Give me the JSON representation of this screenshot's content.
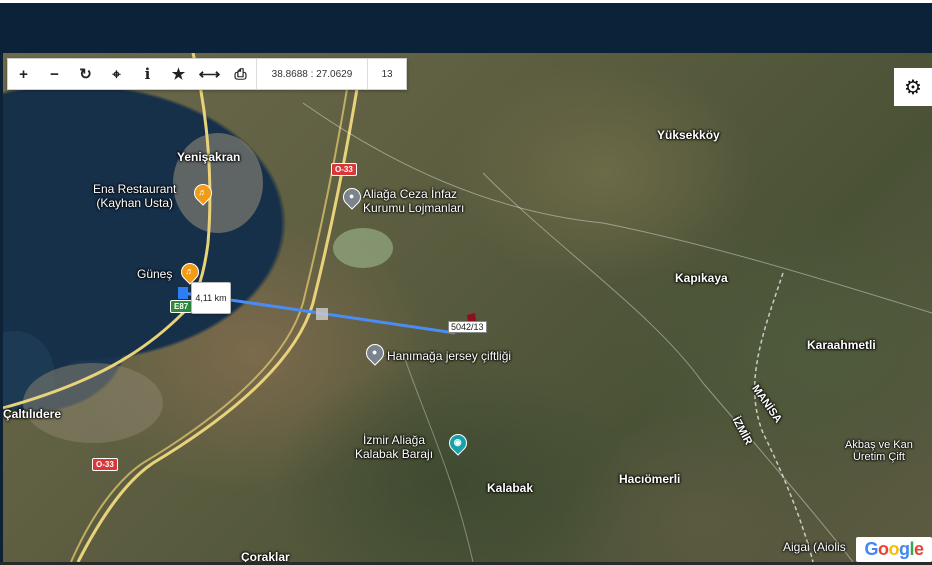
{
  "toolbar": {
    "buttons": [
      {
        "name": "zoom-in-button",
        "icon": "plus-icon",
        "glyph": "+"
      },
      {
        "name": "zoom-out-button",
        "icon": "minus-icon",
        "glyph": "−"
      },
      {
        "name": "refresh-button",
        "icon": "refresh-icon",
        "glyph": "↻"
      },
      {
        "name": "locate-button",
        "icon": "crosshair-icon",
        "glyph": "⌖"
      },
      {
        "name": "info-button",
        "icon": "info-icon",
        "glyph": "i"
      },
      {
        "name": "favorite-button",
        "icon": "star-icon",
        "glyph": "★"
      },
      {
        "name": "measure-button",
        "icon": "measure-icon",
        "glyph": "⟷"
      },
      {
        "name": "print-button",
        "icon": "printer-icon",
        "glyph": "⎙"
      }
    ],
    "coordinates": "38.8688 : 27.0629",
    "zoom_level": "13"
  },
  "settings": {
    "icon": "gear-icon",
    "glyph": "⚙"
  },
  "map": {
    "places": {
      "yenisakran": "Yenişakran",
      "ena_restaurant": "Ena Restaurant\n(Kayhan Usta)",
      "gunes": "Güneş",
      "aliaga_ceza": "Aliağa Ceza İnfaz\nKurumu Lojmanları",
      "yuksekkoy": "Yüksekköy",
      "kapikaya": "Kapıkaya",
      "karaahmetli": "Karaahmetli",
      "hanimaga": "Hanımağa jersey çiftliği",
      "izmir_baraji": "İzmir Aliağa\nKalabak Barajı",
      "kalabak": "Kalabak",
      "haciomerli": "Hacıömerli",
      "caltilidere": "Çaltılıdere",
      "coraklar": "Çoraklar",
      "aigai": "Aigai (Aiolis",
      "akbas": "Akbaş ve Kan\nÜretim Çift",
      "manisa": "MANİSA",
      "izmir": "İZMİR"
    },
    "road_shields": {
      "o33_top": "O-33",
      "o33_bottom": "O-33",
      "e87_top": "E87",
      "e87_mid": "E87"
    },
    "measurement": {
      "distance": "4,11 km",
      "line_color": "#4a8cf5"
    },
    "parcel": {
      "label": "5042/13",
      "color": "#8b1020"
    },
    "attribution": [
      "G",
      "o",
      "o",
      "g",
      "l",
      "e"
    ]
  }
}
